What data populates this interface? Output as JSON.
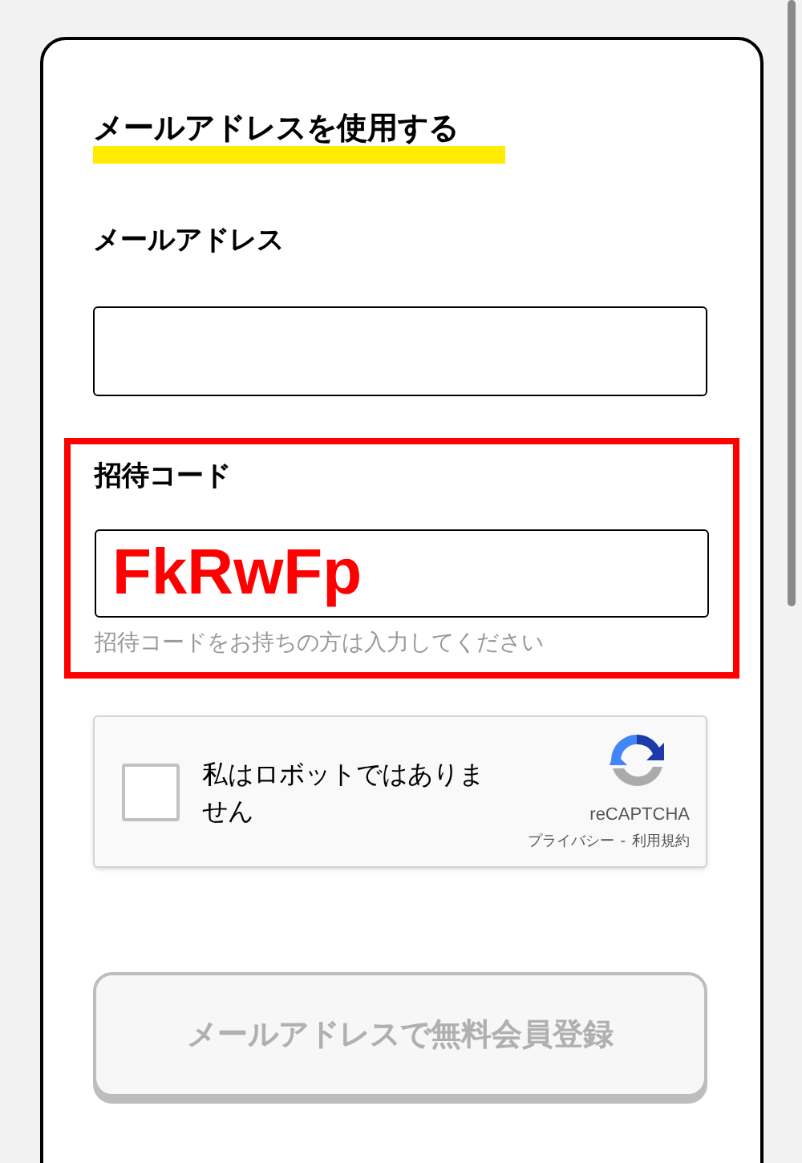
{
  "section_title": "メールアドレスを使用する",
  "email": {
    "label": "メールアドレス"
  },
  "invite": {
    "label": "招待コード",
    "value": "FkRwFp",
    "hint": "招待コードをお持ちの方は入力してください",
    "highlighted": true
  },
  "captcha": {
    "label": "私はロボットではありません",
    "checked": false,
    "brand": "reCAPTCHA",
    "privacy": "プライバシー",
    "separator": "-",
    "terms": "利用規約"
  },
  "submit": {
    "label": "メールアドレスで無料会員登録",
    "disabled": true
  }
}
